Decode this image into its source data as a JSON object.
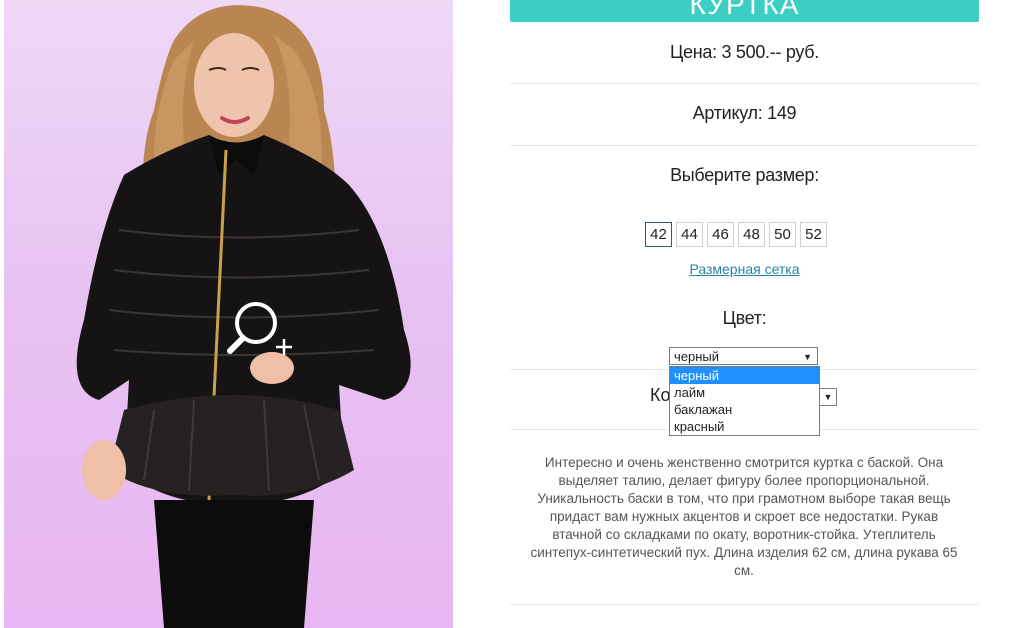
{
  "product": {
    "title": "КУРТКА",
    "price": "Цена: 3 500.-- руб.",
    "article": "Артикул: 149",
    "size_prompt": "Выберите размер:",
    "sizes": [
      "42",
      "44",
      "46",
      "48",
      "50",
      "52"
    ],
    "selected_size": "42",
    "size_chart_link": "Размерная сетка",
    "color_label": "Цвет:",
    "color_selected": "черный",
    "color_options": [
      "черный",
      "лайм",
      "баклажан",
      "красный"
    ],
    "quantity_label_partial": "Ко",
    "description": "Интересно и очень женственно смотрится куртка с баской. Она выделяет талию, делает фигуру более пропорциональной. Уникальность баски в том, что при грамотном выборе такая вещь придаст вам нужных акцентов и скроет все недостатки. Рукав втачной со складками по окату, воротник-стойка. Утеплитель синтепух-синтетический пух. Длина изделия 62 см, длина рукава 65 см."
  },
  "icons": {
    "zoom": "zoom-plus-icon",
    "select_arrow": "dropdown-arrow-icon"
  },
  "colors": {
    "accent": "#3ccdc3",
    "link": "#2a7fa6",
    "dropdown_highlight": "#1e90ff",
    "photo_bg": "#e7c3f1"
  }
}
